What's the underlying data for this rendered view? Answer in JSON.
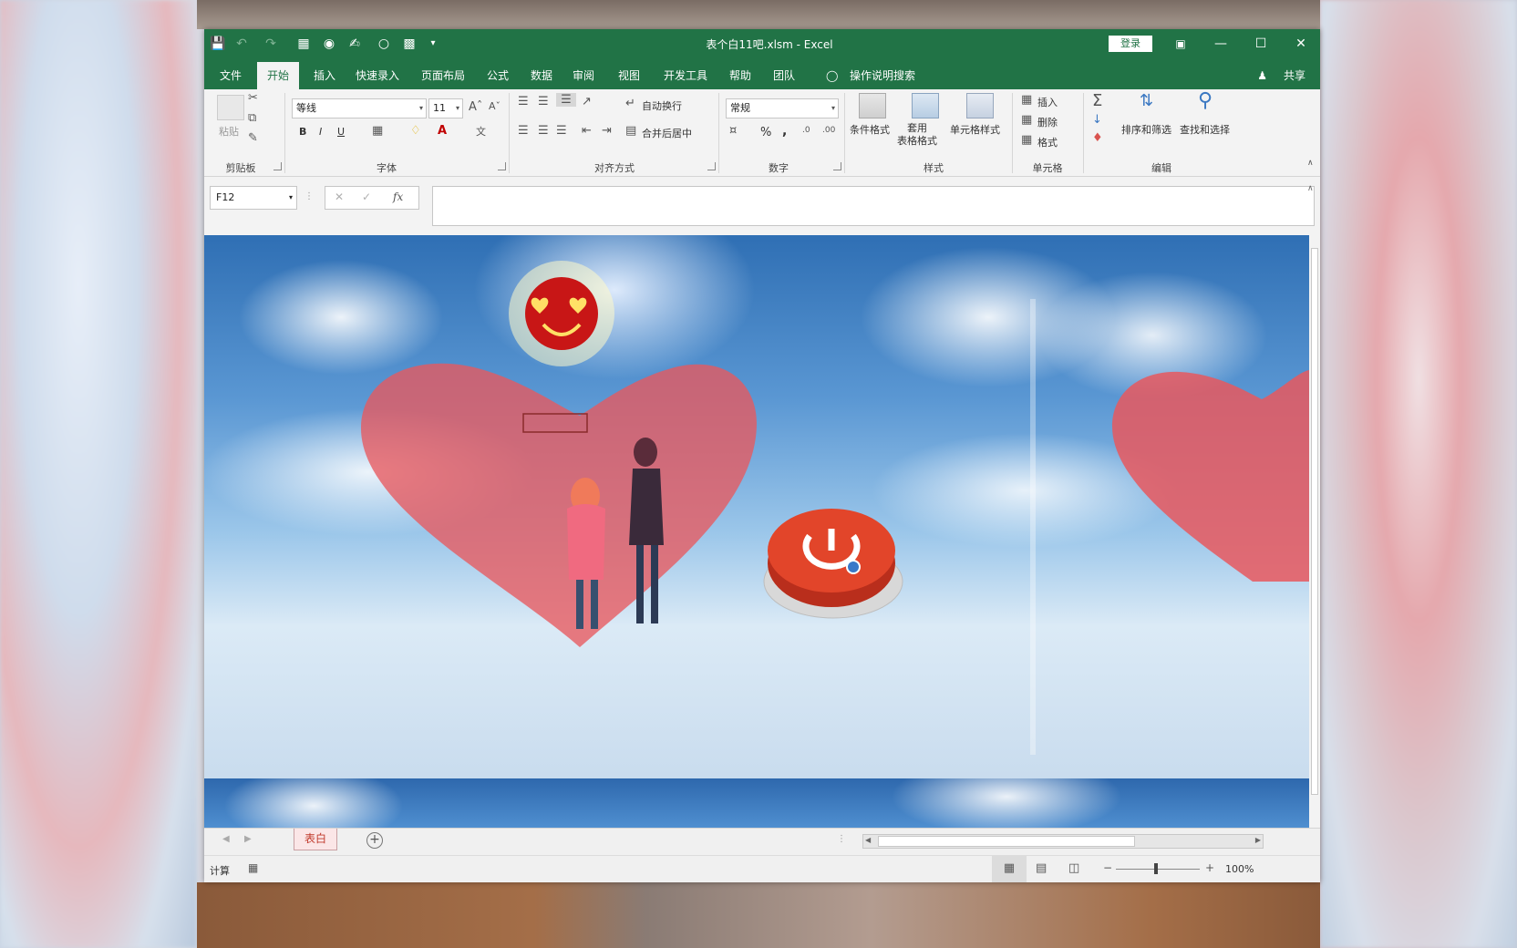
{
  "window": {
    "title": "表个白11吧.xlsm  -  Excel",
    "login_label": "登录"
  },
  "tabs": [
    {
      "label": "文件"
    },
    {
      "label": "开始"
    },
    {
      "label": "插入"
    },
    {
      "label": "快速录入"
    },
    {
      "label": "页面布局"
    },
    {
      "label": "公式"
    },
    {
      "label": "数据"
    },
    {
      "label": "审阅"
    },
    {
      "label": "视图"
    },
    {
      "label": "开发工具"
    },
    {
      "label": "帮助"
    },
    {
      "label": "团队"
    }
  ],
  "tell_me": "操作说明搜索",
  "share": "共享",
  "ribbon": {
    "clipboard": {
      "paste": "粘贴",
      "group": "剪贴板"
    },
    "font": {
      "name": "等线",
      "size": "11",
      "group": "字体",
      "bold": "B",
      "italic": "I",
      "underline": "U"
    },
    "alignment": {
      "wrap": "自动换行",
      "merge": "合并后居中",
      "group": "对齐方式"
    },
    "number": {
      "format": "常规",
      "percent": "%",
      "comma": ",",
      "group": "数字"
    },
    "styles": {
      "conditional": "条件格式",
      "table": "套用\n表格格式",
      "cell_styles": "单元格样式",
      "group": "样式"
    },
    "cells": {
      "insert": "插入",
      "delete": "删除",
      "format": "格式",
      "group": "单元格"
    },
    "editing": {
      "sort": "排序和筛选",
      "find": "查找和选择",
      "group": "编辑"
    }
  },
  "formula_bar": {
    "name_box": "F12",
    "cancel": "✕",
    "enter": "✓",
    "fx": "fx",
    "value": ""
  },
  "sheets": [
    {
      "label": "表白"
    }
  ],
  "status": {
    "mode": "计算",
    "zoom": "100%"
  },
  "colors": {
    "excel_green": "#217346",
    "heart": "#e8585e",
    "smiley": "#c81616",
    "button": "#e2452a"
  },
  "icons": [
    "save-icon",
    "undo-icon",
    "redo-icon",
    "camera-icon",
    "circle-icon",
    "chart-icon",
    "lightbulb-icon",
    "person-icon",
    "smiley-icon",
    "power-icon"
  ]
}
